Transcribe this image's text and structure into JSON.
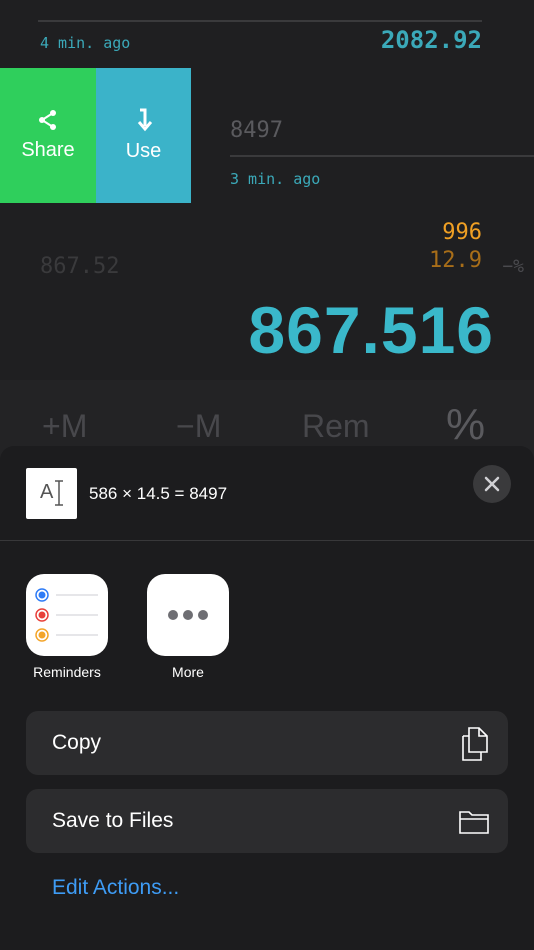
{
  "history": {
    "item1": {
      "time": "4 min. ago",
      "value": "2082.92"
    },
    "swipe": {
      "share_label": "Share",
      "use_label": "Use"
    },
    "item2": {
      "value": "8497",
      "time": "3 min. ago"
    }
  },
  "calculator": {
    "operand1": "996",
    "operand2": "12.9",
    "operator": "−%",
    "previous": "867.52",
    "result": "867.516",
    "memory_buttons": [
      "+M",
      "−M",
      "Rem",
      "%"
    ]
  },
  "share_sheet": {
    "header_text": "586 × 14.5 = 8497",
    "thumbnail_text": "A",
    "apps": [
      {
        "label": "Reminders",
        "icon": "reminders-icon"
      },
      {
        "label": "More",
        "icon": "more-icon"
      }
    ],
    "actions": [
      {
        "label": "Copy",
        "icon": "copy-icon"
      },
      {
        "label": "Save to Files",
        "icon": "folder-icon"
      }
    ],
    "edit_actions_label": "Edit Actions..."
  },
  "colors": {
    "accent_teal": "#3ab8ca",
    "share_green": "#2fcf5c",
    "use_blue": "#3bb3c9",
    "orange": "#f0a024",
    "link_blue": "#3e9cf5"
  }
}
